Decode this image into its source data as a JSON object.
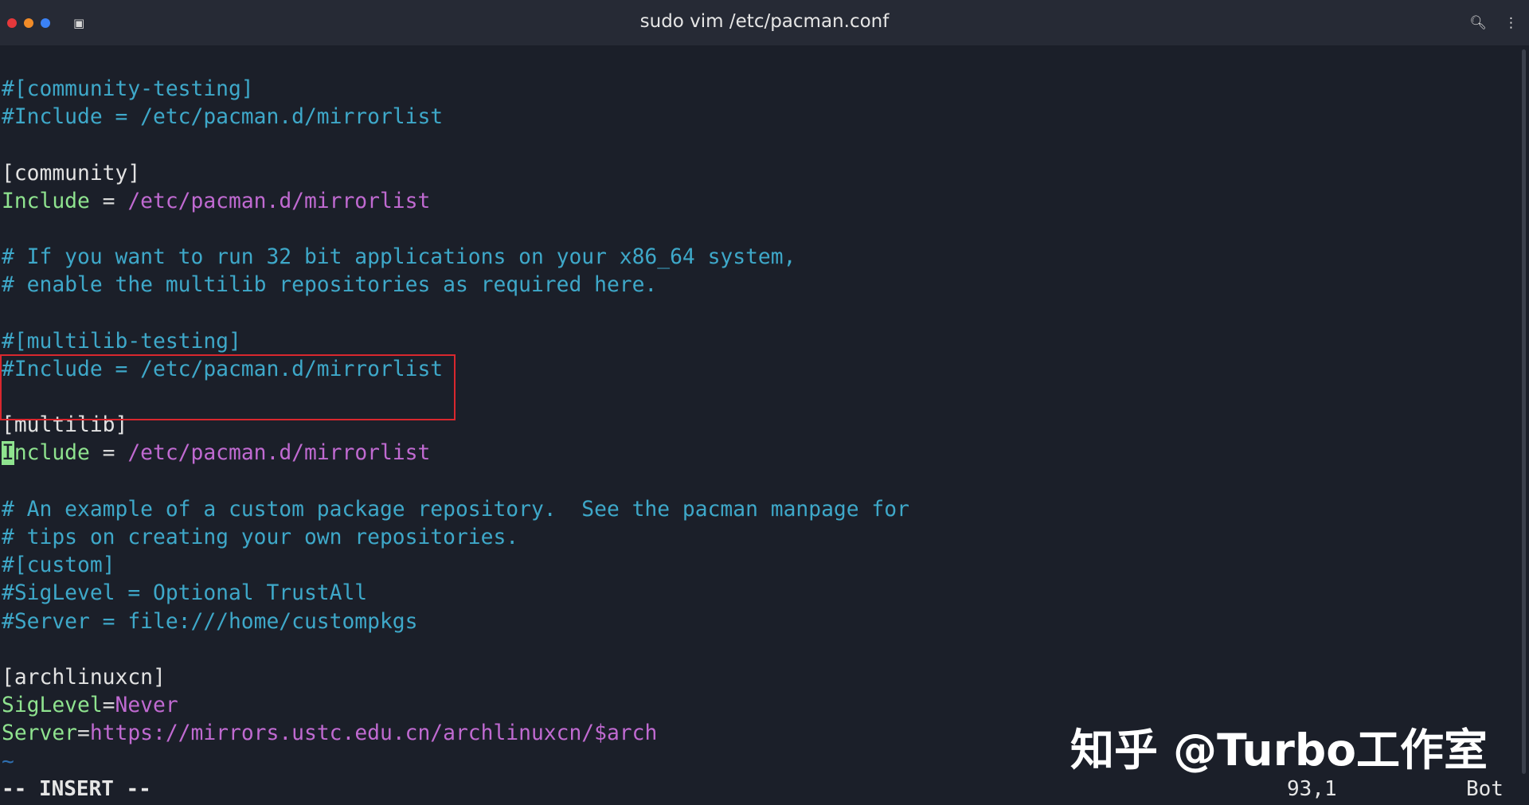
{
  "window": {
    "title": "sudo vim /etc/pacman.conf",
    "icons": [
      "terminal-icon",
      "search-icon",
      "more-icon"
    ],
    "colors": {
      "close": "#e5383b",
      "minimize": "#f28c28",
      "maximize": "#3b82f6"
    }
  },
  "editor": {
    "lines": [
      {
        "type": "comment",
        "text": "#[community-testing]"
      },
      {
        "type": "comment",
        "text": "#Include = /etc/pacman.d/mirrorlist"
      },
      {
        "type": "blank",
        "text": ""
      },
      {
        "type": "section",
        "text": "[community]"
      },
      {
        "type": "kv",
        "key": "Include",
        "op": " = ",
        "value": "/etc/pacman.d/mirrorlist"
      },
      {
        "type": "blank",
        "text": ""
      },
      {
        "type": "comment",
        "text": "# If you want to run 32 bit applications on your x86_64 system,"
      },
      {
        "type": "comment",
        "text": "# enable the multilib repositories as required here."
      },
      {
        "type": "blank",
        "text": ""
      },
      {
        "type": "comment",
        "text": "#[multilib-testing]"
      },
      {
        "type": "comment",
        "text": "#Include = /etc/pacman.d/mirrorlist"
      },
      {
        "type": "blank",
        "text": ""
      },
      {
        "type": "section",
        "text": "[multilib]"
      },
      {
        "type": "kv",
        "key": "Include",
        "op": " = ",
        "value": "/etc/pacman.d/mirrorlist",
        "cursor": true
      },
      {
        "type": "blank",
        "text": ""
      },
      {
        "type": "comment",
        "text": "# An example of a custom package repository.  See the pacman manpage for"
      },
      {
        "type": "comment",
        "text": "# tips on creating your own repositories."
      },
      {
        "type": "comment",
        "text": "#[custom]"
      },
      {
        "type": "comment",
        "text": "#SigLevel = Optional TrustAll"
      },
      {
        "type": "comment",
        "text": "#Server = file:///home/custompkgs"
      },
      {
        "type": "blank",
        "text": ""
      },
      {
        "type": "section",
        "text": "[archlinuxcn]"
      },
      {
        "type": "kv",
        "key": "SigLevel",
        "op": "=",
        "value": "Never"
      },
      {
        "type": "kv",
        "key": "Server",
        "op": "=",
        "value": "https://mirrors.ustc.edu.cn/archlinuxcn/$arch"
      },
      {
        "type": "tilde",
        "text": "~"
      }
    ]
  },
  "status": {
    "mode": "-- INSERT --",
    "position": "93,1",
    "scroll": "Bot"
  },
  "watermark": "知乎 @Turbo工作室"
}
